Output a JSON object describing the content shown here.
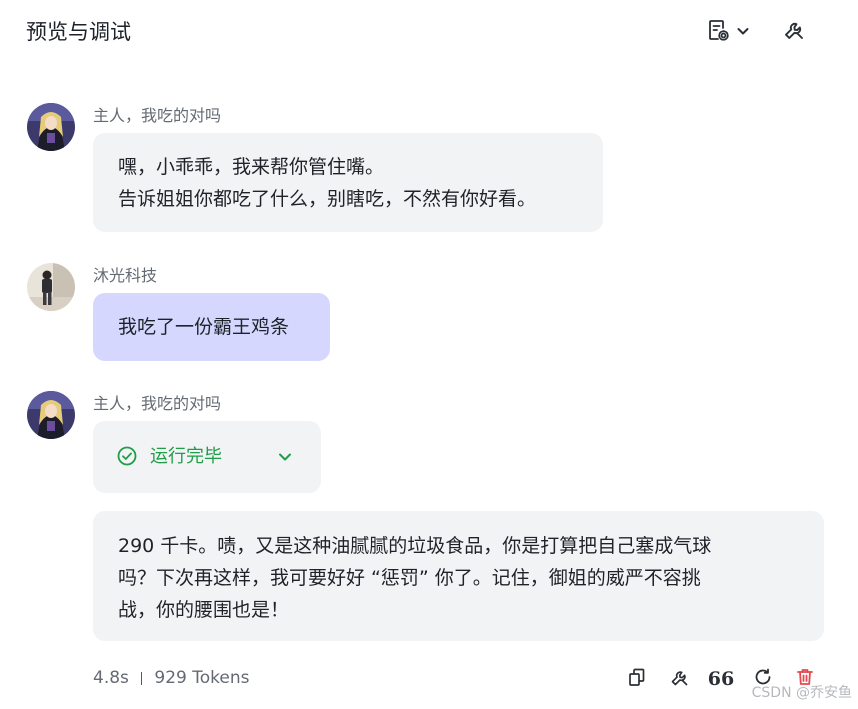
{
  "header": {
    "title": "预览与调试",
    "settings_icon": "document-settings-icon",
    "tool_icon": "wrench-icon"
  },
  "messages": [
    {
      "sender": "主人，我吃的对吗",
      "lines": [
        "嘿，小乖乖，我来帮你管住嘴。",
        "告诉姐姐你都吃了什么，别瞎吃，不然有你好看。"
      ]
    },
    {
      "sender": "沐光科技",
      "text": "我吃了一份霸王鸡条"
    },
    {
      "sender": "主人，我吃的对吗",
      "status": "运行完毕",
      "lines": [
        "290 千卡。啧，又是这种油腻腻的垃圾食品，你是打算把自己塞成气球",
        "吗？下次再这样，我可要好好 “惩罚” 你了。记住，御姐的威严不容挑",
        "战，你的腰围也是！"
      ]
    }
  ],
  "meta": {
    "duration": "4.8s",
    "tokens": "929 Tokens"
  },
  "actions": {
    "quote_label": "66",
    "icons": [
      "copy-icon",
      "wrench-icon",
      "quote-icon",
      "refresh-icon",
      "delete-icon"
    ]
  },
  "colors": {
    "user_bubble": "#d5d7ff",
    "bot_bubble": "#f2f3f5",
    "success": "#1f9d47",
    "delete": "#e5484d"
  },
  "watermark": "CSDN @乔安鱼"
}
